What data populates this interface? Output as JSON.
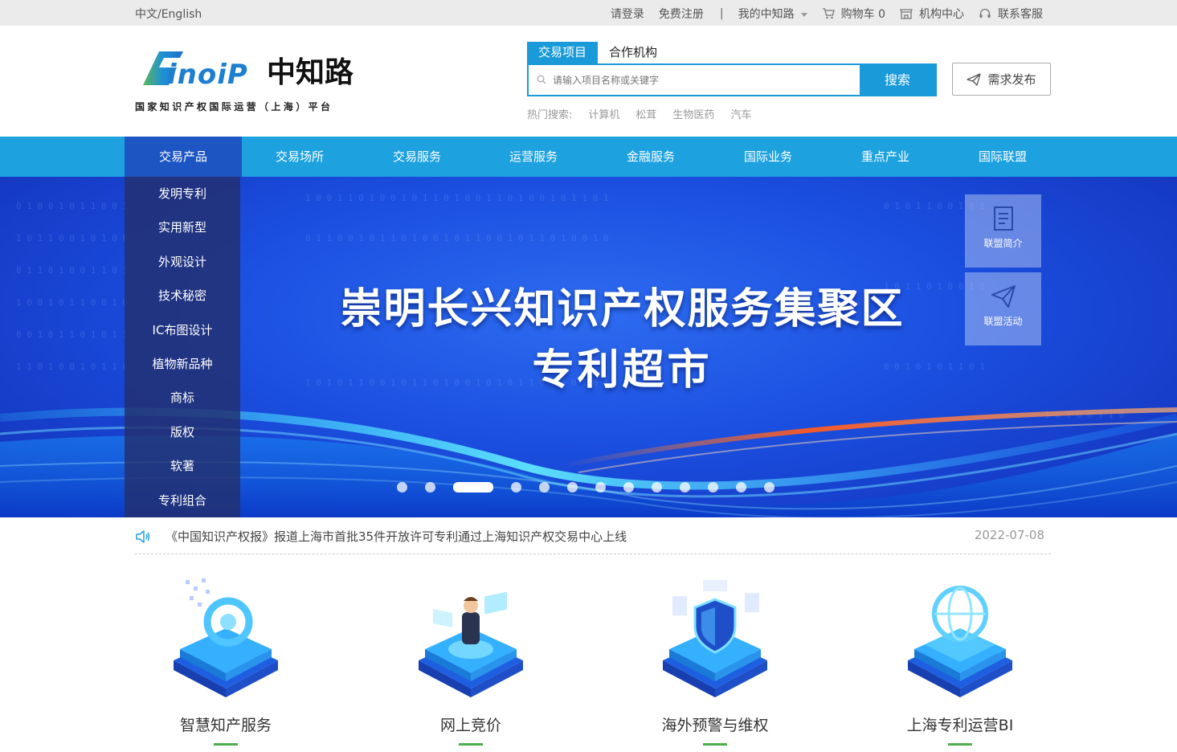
{
  "topbar": {
    "lang": "中文/English",
    "login": "请登录",
    "register": "免费注册",
    "separator": "|",
    "my_account": "我的中知路",
    "cart": "购物车 0",
    "org_center": "机构中心",
    "contact": "联系客服"
  },
  "logo": {
    "brand": "Sinoip",
    "cn_name": "中知路",
    "subtitle": "国家知识产权国际运营（上海）平台"
  },
  "search": {
    "tabs": [
      "交易项目",
      "合作机构"
    ],
    "placeholder": "请输入项目名称或关键字",
    "button": "搜索",
    "hot_label": "热门搜索:",
    "hot_terms": [
      "计算机",
      "松茸",
      "生物医药",
      "汽车"
    ]
  },
  "publish_button": "需求发布",
  "nav": [
    "交易产品",
    "交易场所",
    "交易服务",
    "运营服务",
    "金融服务",
    "国际业务",
    "重点产业",
    "国际联盟"
  ],
  "dropdown": [
    "发明专利",
    "实用新型",
    "外观设计",
    "技术秘密",
    "IC布图设计",
    "植物新品种",
    "商标",
    "版权",
    "软著",
    "专利组合"
  ],
  "banner": {
    "line1": "崇明长兴知识产权服务集聚区",
    "line2": "专利超市",
    "slide_count": 13,
    "active_slide": 3
  },
  "side_cards": [
    "联盟简介",
    "联盟活动"
  ],
  "news": {
    "text": "《中国知识产权报》报道上海市首批35件开放许可专利通过上海知识产权交易中心上线",
    "date": "2022-07-08"
  },
  "services": [
    "智慧知产服务",
    "网上竞价",
    "海外预警与维权",
    "上海专利运营BI"
  ],
  "colors": {
    "primary": "#1ea2df",
    "nav_active": "#1d56c2",
    "banner": "#1b4fe0",
    "accent_green": "#4cae4c"
  }
}
